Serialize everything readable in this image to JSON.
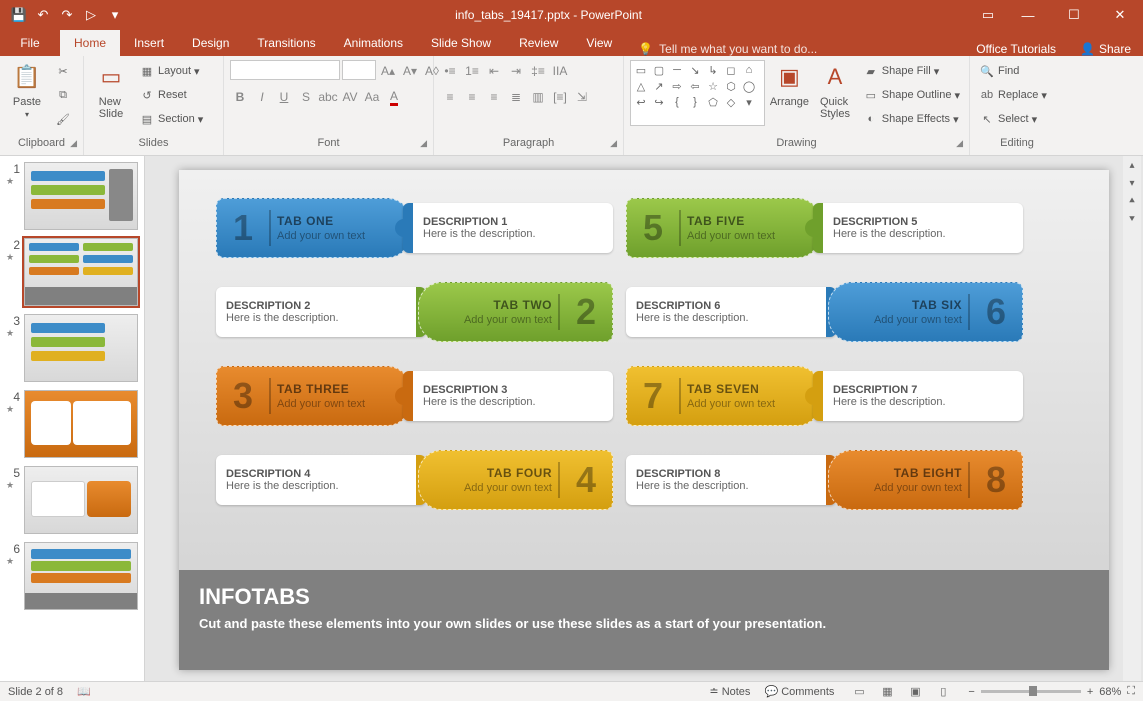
{
  "title": {
    "filename": "info_tabs_19417.pptx",
    "app": "PowerPoint"
  },
  "qat": {
    "save": "💾",
    "undo": "↶",
    "redo": "↷",
    "start": "▷",
    "more": "▾"
  },
  "tabs": {
    "file": "File",
    "home": "Home",
    "insert": "Insert",
    "design": "Design",
    "transitions": "Transitions",
    "animations": "Animations",
    "slideshow": "Slide Show",
    "review": "Review",
    "view": "View",
    "tellme": "Tell me what you want to do...",
    "tutorials": "Office Tutorials",
    "share": "Share"
  },
  "ribbon": {
    "clipboard": {
      "label": "Clipboard",
      "paste": "Paste"
    },
    "slides": {
      "label": "Slides",
      "newslide": "New\nSlide",
      "layout": "Layout",
      "reset": "Reset",
      "section": "Section"
    },
    "font": {
      "label": "Font"
    },
    "paragraph": {
      "label": "Paragraph"
    },
    "drawing": {
      "label": "Drawing",
      "arrange": "Arrange",
      "quick": "Quick\nStyles",
      "fill": "Shape Fill",
      "outline": "Shape Outline",
      "effects": "Shape Effects"
    },
    "editing": {
      "label": "Editing",
      "find": "Find",
      "replace": "Replace",
      "select": "Select"
    }
  },
  "slide": {
    "tabs": [
      {
        "n": "1",
        "label": "TAB ONE",
        "sub": "Add your own text",
        "dt": "DESCRIPTION 1",
        "db": "Here is the description.",
        "cls": "c-blue",
        "mode": "L"
      },
      {
        "n": "2",
        "label": "TAB TWO",
        "sub": "Add your own text",
        "dt": "DESCRIPTION 2",
        "db": "Here is the description.",
        "cls": "c-green",
        "mode": "R"
      },
      {
        "n": "3",
        "label": "TAB THREE",
        "sub": "Add your own text",
        "dt": "DESCRIPTION 3",
        "db": "Here is the description.",
        "cls": "c-orange",
        "mode": "L"
      },
      {
        "n": "4",
        "label": "TAB FOUR",
        "sub": "Add your own text",
        "dt": "DESCRIPTION 4",
        "db": "Here is the description.",
        "cls": "c-yellow",
        "mode": "R"
      },
      {
        "n": "5",
        "label": "TAB FIVE",
        "sub": "Add your own text",
        "dt": "DESCRIPTION 5",
        "db": "Here is the description.",
        "cls": "c-green",
        "mode": "L"
      },
      {
        "n": "6",
        "label": "TAB SIX",
        "sub": "Add your own text",
        "dt": "DESCRIPTION 6",
        "db": "Here is the description.",
        "cls": "c-blue",
        "mode": "R"
      },
      {
        "n": "7",
        "label": "TAB SEVEN",
        "sub": "Add your own text",
        "dt": "DESCRIPTION 7",
        "db": "Here is the description.",
        "cls": "c-yellow",
        "mode": "L"
      },
      {
        "n": "8",
        "label": "TAB EIGHT",
        "sub": "Add your own text",
        "dt": "DESCRIPTION 8",
        "db": "Here is the description.",
        "cls": "c-orange",
        "mode": "R"
      }
    ],
    "footer": {
      "title": "INFOTABS",
      "body": "Cut and paste these elements into your own slides or use these slides as a start of your presentation."
    }
  },
  "status": {
    "slide": "Slide 2 of 8",
    "notes": "Notes",
    "comments": "Comments",
    "zoom": "68%"
  }
}
